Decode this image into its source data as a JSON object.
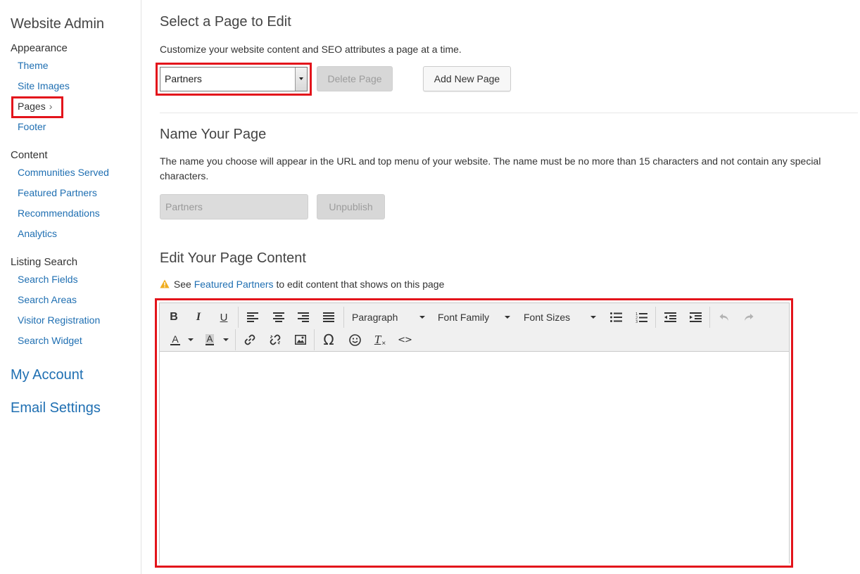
{
  "sidebar": {
    "title": "Website Admin",
    "sections": [
      {
        "label": "Appearance",
        "items": [
          "Theme",
          "Site Images",
          "Pages",
          "Footer"
        ]
      },
      {
        "label": "Content",
        "items": [
          "Communities Served",
          "Featured Partners",
          "Recommendations",
          "Analytics"
        ]
      },
      {
        "label": "Listing Search",
        "items": [
          "Search Fields",
          "Search Areas",
          "Visitor Registration",
          "Search Widget"
        ]
      }
    ],
    "active_item": "Pages",
    "active_chevron": "›",
    "my_account": "My Account",
    "email_settings": "Email Settings"
  },
  "select_page": {
    "heading": "Select a Page to Edit",
    "description": "Customize your website content and SEO attributes a page at a time.",
    "selected_value": "Partners",
    "delete_label": "Delete Page",
    "add_label": "Add New Page"
  },
  "name_page": {
    "heading": "Name Your Page",
    "description_line1": "The name you choose will appear in the URL and top menu of your website. The name must be no more than 15 characters and not contain any special",
    "description_line2": "characters.",
    "input_value": "Partners",
    "unpublish_label": "Unpublish"
  },
  "edit_content": {
    "heading": "Edit Your Page Content",
    "notice_prefix": "See",
    "notice_link": "Featured Partners",
    "notice_suffix": "to edit content that shows on this page"
  },
  "editor": {
    "bold": "B",
    "italic": "I",
    "underline": "U",
    "format_label": "Paragraph",
    "font_family_label": "Font Family",
    "font_size_label": "Font Sizes",
    "text_color_letter": "A",
    "bg_color_letter": "A",
    "omega": "Ω",
    "code": "<>",
    "clear_format": "T"
  },
  "colors": {
    "link": "#1f6fb2",
    "highlight": "#e3141b",
    "warning": "#f0ad1e"
  }
}
